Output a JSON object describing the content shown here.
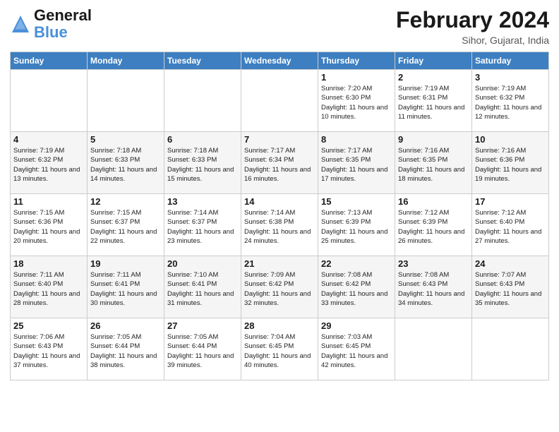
{
  "header": {
    "logo_line1": "General",
    "logo_line2": "Blue",
    "month_title": "February 2024",
    "location": "Sihor, Gujarat, India"
  },
  "weekdays": [
    "Sunday",
    "Monday",
    "Tuesday",
    "Wednesday",
    "Thursday",
    "Friday",
    "Saturday"
  ],
  "weeks": [
    [
      {
        "day": "",
        "info": ""
      },
      {
        "day": "",
        "info": ""
      },
      {
        "day": "",
        "info": ""
      },
      {
        "day": "",
        "info": ""
      },
      {
        "day": "1",
        "info": "Sunrise: 7:20 AM\nSunset: 6:30 PM\nDaylight: 11 hours\nand 10 minutes."
      },
      {
        "day": "2",
        "info": "Sunrise: 7:19 AM\nSunset: 6:31 PM\nDaylight: 11 hours\nand 11 minutes."
      },
      {
        "day": "3",
        "info": "Sunrise: 7:19 AM\nSunset: 6:32 PM\nDaylight: 11 hours\nand 12 minutes."
      }
    ],
    [
      {
        "day": "4",
        "info": "Sunrise: 7:19 AM\nSunset: 6:32 PM\nDaylight: 11 hours\nand 13 minutes."
      },
      {
        "day": "5",
        "info": "Sunrise: 7:18 AM\nSunset: 6:33 PM\nDaylight: 11 hours\nand 14 minutes."
      },
      {
        "day": "6",
        "info": "Sunrise: 7:18 AM\nSunset: 6:33 PM\nDaylight: 11 hours\nand 15 minutes."
      },
      {
        "day": "7",
        "info": "Sunrise: 7:17 AM\nSunset: 6:34 PM\nDaylight: 11 hours\nand 16 minutes."
      },
      {
        "day": "8",
        "info": "Sunrise: 7:17 AM\nSunset: 6:35 PM\nDaylight: 11 hours\nand 17 minutes."
      },
      {
        "day": "9",
        "info": "Sunrise: 7:16 AM\nSunset: 6:35 PM\nDaylight: 11 hours\nand 18 minutes."
      },
      {
        "day": "10",
        "info": "Sunrise: 7:16 AM\nSunset: 6:36 PM\nDaylight: 11 hours\nand 19 minutes."
      }
    ],
    [
      {
        "day": "11",
        "info": "Sunrise: 7:15 AM\nSunset: 6:36 PM\nDaylight: 11 hours\nand 20 minutes."
      },
      {
        "day": "12",
        "info": "Sunrise: 7:15 AM\nSunset: 6:37 PM\nDaylight: 11 hours\nand 22 minutes."
      },
      {
        "day": "13",
        "info": "Sunrise: 7:14 AM\nSunset: 6:37 PM\nDaylight: 11 hours\nand 23 minutes."
      },
      {
        "day": "14",
        "info": "Sunrise: 7:14 AM\nSunset: 6:38 PM\nDaylight: 11 hours\nand 24 minutes."
      },
      {
        "day": "15",
        "info": "Sunrise: 7:13 AM\nSunset: 6:39 PM\nDaylight: 11 hours\nand 25 minutes."
      },
      {
        "day": "16",
        "info": "Sunrise: 7:12 AM\nSunset: 6:39 PM\nDaylight: 11 hours\nand 26 minutes."
      },
      {
        "day": "17",
        "info": "Sunrise: 7:12 AM\nSunset: 6:40 PM\nDaylight: 11 hours\nand 27 minutes."
      }
    ],
    [
      {
        "day": "18",
        "info": "Sunrise: 7:11 AM\nSunset: 6:40 PM\nDaylight: 11 hours\nand 28 minutes."
      },
      {
        "day": "19",
        "info": "Sunrise: 7:11 AM\nSunset: 6:41 PM\nDaylight: 11 hours\nand 30 minutes."
      },
      {
        "day": "20",
        "info": "Sunrise: 7:10 AM\nSunset: 6:41 PM\nDaylight: 11 hours\nand 31 minutes."
      },
      {
        "day": "21",
        "info": "Sunrise: 7:09 AM\nSunset: 6:42 PM\nDaylight: 11 hours\nand 32 minutes."
      },
      {
        "day": "22",
        "info": "Sunrise: 7:08 AM\nSunset: 6:42 PM\nDaylight: 11 hours\nand 33 minutes."
      },
      {
        "day": "23",
        "info": "Sunrise: 7:08 AM\nSunset: 6:43 PM\nDaylight: 11 hours\nand 34 minutes."
      },
      {
        "day": "24",
        "info": "Sunrise: 7:07 AM\nSunset: 6:43 PM\nDaylight: 11 hours\nand 35 minutes."
      }
    ],
    [
      {
        "day": "25",
        "info": "Sunrise: 7:06 AM\nSunset: 6:43 PM\nDaylight: 11 hours\nand 37 minutes."
      },
      {
        "day": "26",
        "info": "Sunrise: 7:05 AM\nSunset: 6:44 PM\nDaylight: 11 hours\nand 38 minutes."
      },
      {
        "day": "27",
        "info": "Sunrise: 7:05 AM\nSunset: 6:44 PM\nDaylight: 11 hours\nand 39 minutes."
      },
      {
        "day": "28",
        "info": "Sunrise: 7:04 AM\nSunset: 6:45 PM\nDaylight: 11 hours\nand 40 minutes."
      },
      {
        "day": "29",
        "info": "Sunrise: 7:03 AM\nSunset: 6:45 PM\nDaylight: 11 hours\nand 42 minutes."
      },
      {
        "day": "",
        "info": ""
      },
      {
        "day": "",
        "info": ""
      }
    ]
  ]
}
